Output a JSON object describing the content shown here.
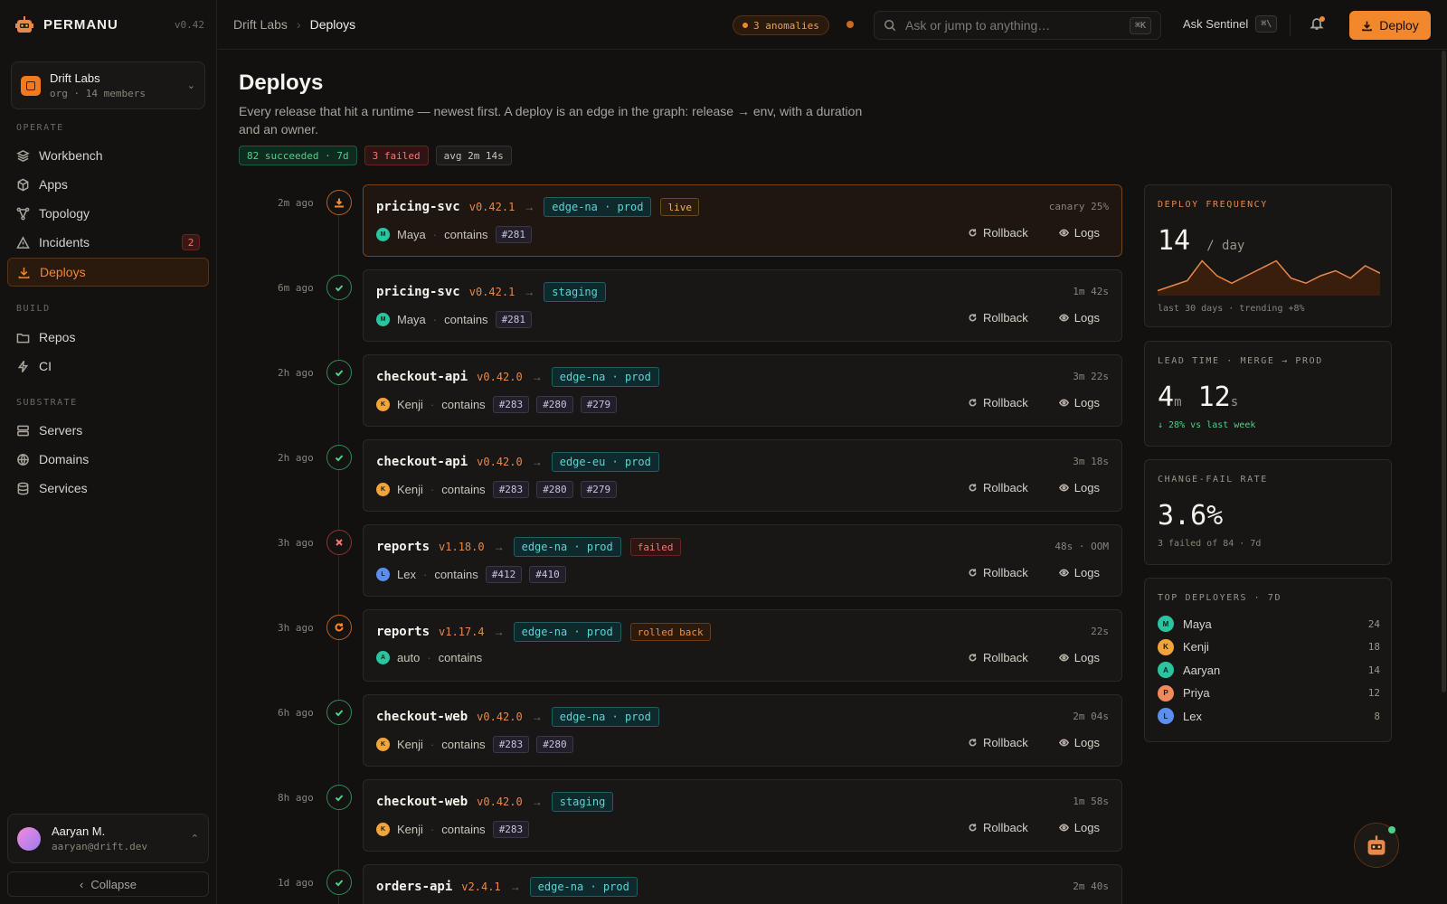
{
  "brand": {
    "name": "PERMANU",
    "version": "v0.42"
  },
  "org": {
    "name": "Drift Labs",
    "sub": "org · 14 members"
  },
  "sections": {
    "operate": "OPERATE",
    "build": "BUILD",
    "substrate": "SUBSTRATE"
  },
  "nav": {
    "workbench": "Workbench",
    "apps": "Apps",
    "topology": "Topology",
    "incidents": "Incidents",
    "incidents_badge": "2",
    "deploys": "Deploys",
    "repos": "Repos",
    "ci": "CI",
    "servers": "Servers",
    "domains": "Domains",
    "services": "Services"
  },
  "user": {
    "name": "Aaryan M.",
    "email": "aaryan@drift.dev"
  },
  "collapse": "Collapse",
  "topbar": {
    "crumb_org": "Drift Labs",
    "crumb_sep": "›",
    "crumb_page": "Deploys",
    "anomalies": "3 anomalies",
    "search_placeholder": "Ask or jump to anything…",
    "search_kbd": "⌘K",
    "ask": "Ask Sentinel",
    "ask_kbd": "⌘\\",
    "deploy_btn": "Deploy"
  },
  "page": {
    "title": "Deploys",
    "desc": "Every release that hit a runtime — newest first. A deploy is an edge in the graph: release → env, with a duration and an owner.",
    "stat_ok": "82 succeeded · 7d",
    "stat_fail": "3 failed",
    "stat_avg": "avg 2m 14s"
  },
  "labels": {
    "contains": "contains",
    "rollback": "Rollback",
    "logs": "Logs",
    "arrow": "→",
    "dot": "·"
  },
  "deploys": [
    {
      "ago": "2m ago",
      "status": "live",
      "svc": "pricing-svc",
      "ver": "v0.42.1",
      "env": "edge-na · prod",
      "tag": "live",
      "meta": "canary 25%",
      "who": "Maya",
      "init": "M",
      "color": "#2bc4a0",
      "prs": [
        "#281"
      ]
    },
    {
      "ago": "6m ago",
      "status": "ok",
      "svc": "pricing-svc",
      "ver": "v0.42.1",
      "env": "staging",
      "tag": "",
      "meta": "1m 42s",
      "who": "Maya",
      "init": "M",
      "color": "#2bc4a0",
      "prs": [
        "#281"
      ]
    },
    {
      "ago": "2h ago",
      "status": "ok",
      "svc": "checkout-api",
      "ver": "v0.42.0",
      "env": "edge-na · prod",
      "tag": "",
      "meta": "3m 22s",
      "who": "Kenji",
      "init": "K",
      "color": "#f2a43a",
      "prs": [
        "#283",
        "#280",
        "#279"
      ]
    },
    {
      "ago": "2h ago",
      "status": "ok",
      "svc": "checkout-api",
      "ver": "v0.42.0",
      "env": "edge-eu · prod",
      "tag": "",
      "meta": "3m 18s",
      "who": "Kenji",
      "init": "K",
      "color": "#f2a43a",
      "prs": [
        "#283",
        "#280",
        "#279"
      ]
    },
    {
      "ago": "3h ago",
      "status": "fail",
      "svc": "reports",
      "ver": "v1.18.0",
      "env": "edge-na · prod",
      "tag": "failed",
      "meta": "48s · OOM",
      "who": "Lex",
      "init": "L",
      "color": "#5b8ef0",
      "prs": [
        "#412",
        "#410"
      ]
    },
    {
      "ago": "3h ago",
      "status": "rb",
      "svc": "reports",
      "ver": "v1.17.4",
      "env": "edge-na · prod",
      "tag": "rolled back",
      "meta": "22s",
      "who": "auto",
      "init": "A",
      "color": "#2bc4a0",
      "prs": []
    },
    {
      "ago": "6h ago",
      "status": "ok",
      "svc": "checkout-web",
      "ver": "v0.42.0",
      "env": "edge-na · prod",
      "tag": "",
      "meta": "2m 04s",
      "who": "Kenji",
      "init": "K",
      "color": "#f2a43a",
      "prs": [
        "#283",
        "#280"
      ]
    },
    {
      "ago": "8h ago",
      "status": "ok",
      "svc": "checkout-web",
      "ver": "v0.42.0",
      "env": "staging",
      "tag": "",
      "meta": "1m 58s",
      "who": "Kenji",
      "init": "K",
      "color": "#f2a43a",
      "prs": [
        "#283"
      ]
    },
    {
      "ago": "1d ago",
      "status": "ok",
      "svc": "orders-api",
      "ver": "v2.4.1",
      "env": "edge-na · prod",
      "tag": "",
      "meta": "2m 40s",
      "who": "",
      "init": "",
      "color": "#2bc4a0",
      "prs": []
    }
  ],
  "panels": {
    "freq": {
      "label": "DEPLOY FREQUENCY",
      "value": "14",
      "unit": "/ day",
      "sub": "last 30 days · trending +8%",
      "chart_data": {
        "type": "area",
        "values": [
          2,
          4,
          6,
          14,
          8,
          5,
          8,
          11,
          14,
          7,
          5,
          8,
          10,
          7,
          12,
          9
        ],
        "ylim": [
          0,
          16
        ]
      }
    },
    "lead": {
      "label": "LEAD TIME · MERGE → PROD",
      "m": "4",
      "m_unit": "m",
      "s": "12",
      "s_unit": "s",
      "sub": "↓ 28% vs last week"
    },
    "cfr": {
      "label": "CHANGE-FAIL RATE",
      "value": "3.6%",
      "sub": "3 failed of 84 · 7d"
    },
    "top": {
      "label": "TOP DEPLOYERS · 7D",
      "people": [
        {
          "init": "M",
          "name": "Maya",
          "n": "24",
          "color": "#2bc4a0"
        },
        {
          "init": "K",
          "name": "Kenji",
          "n": "18",
          "color": "#f2a43a"
        },
        {
          "init": "A",
          "name": "Aaryan",
          "n": "14",
          "color": "#2bc4a0"
        },
        {
          "init": "P",
          "name": "Priya",
          "n": "12",
          "color": "#f08a5a"
        },
        {
          "init": "L",
          "name": "Lex",
          "n": "8",
          "color": "#5b8ef0"
        }
      ]
    }
  }
}
